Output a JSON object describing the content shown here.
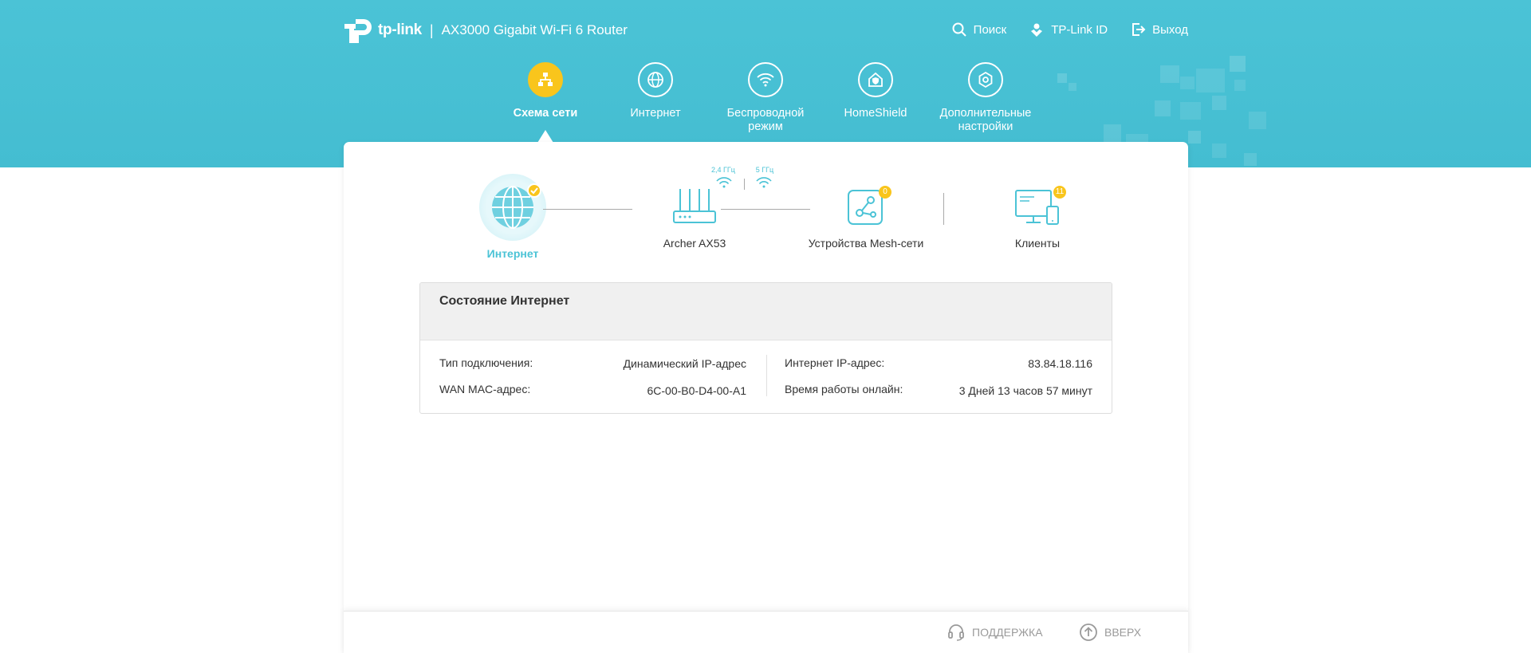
{
  "header": {
    "brand": "tp-link",
    "separator": "|",
    "model": "AX3000 Gigabit Wi-Fi 6 Router",
    "links": {
      "search": "Поиск",
      "tplink_id": "TP-Link ID",
      "logout": "Выход"
    }
  },
  "nav": {
    "items": [
      {
        "label": "Схема сети",
        "icon": "network-map-icon",
        "active": true
      },
      {
        "label": "Интернет",
        "icon": "globe-icon"
      },
      {
        "label": "Беспроводной режим",
        "icon": "wifi-icon"
      },
      {
        "label": "HomeShield",
        "icon": "homeshield-icon"
      },
      {
        "label": "Дополнительные настройки",
        "icon": "gear-icon"
      }
    ]
  },
  "topology": {
    "internet": "Интернет",
    "router": "Archer AX53",
    "band_24": "2,4 ГГц",
    "band_5": "5 ГГц",
    "mesh": "Устройства Mesh-сети",
    "mesh_count": "0",
    "clients": "Клиенты",
    "clients_count": "11"
  },
  "status": {
    "title": "Состояние Интернет",
    "connection_type_label": "Тип подключения:",
    "connection_type_value": "Динамический IP-адрес",
    "wan_mac_label": "WAN MAC-адрес:",
    "wan_mac_value": "6C-00-B0-D4-00-A1",
    "ip_label": "Интернет IP-адрес:",
    "ip_value": "83.84.18.116",
    "uptime_label": "Время работы онлайн:",
    "uptime_value": "3 Дней 13 часов 57 минут"
  },
  "footer": {
    "support": "ПОДДЕРЖКА",
    "top": "ВВЕРХ"
  },
  "colors": {
    "accent": "#4bc3d6",
    "active_nav": "#f9c51c"
  }
}
